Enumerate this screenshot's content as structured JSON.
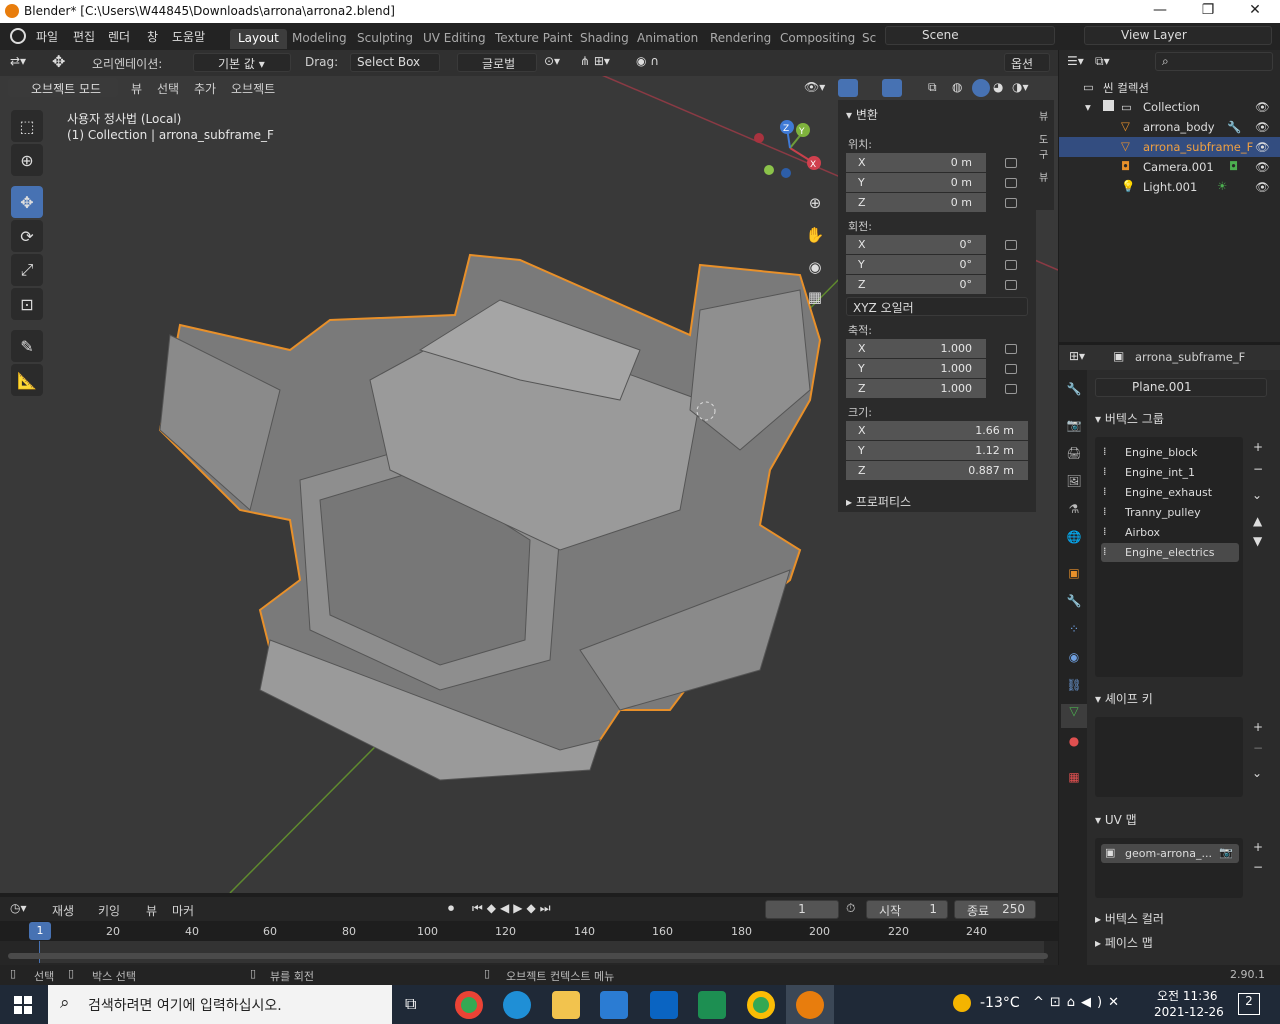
{
  "window": {
    "title": "Blender* [C:\\Users\\W44845\\Downloads\\arrona\\arrona2.blend]"
  },
  "menu": [
    "파일",
    "편집",
    "렌더",
    "창",
    "도움말"
  ],
  "workspace_tabs": [
    {
      "label": "Layout",
      "active": true
    },
    {
      "label": "Modeling"
    },
    {
      "label": "Sculpting"
    },
    {
      "label": "UV Editing"
    },
    {
      "label": "Texture Paint"
    },
    {
      "label": "Shading"
    },
    {
      "label": "Animation"
    },
    {
      "label": "Rendering"
    },
    {
      "label": "Compositing"
    },
    {
      "label": "Sc"
    }
  ],
  "scene": {
    "name": "Scene",
    "view_layer": "View Layer"
  },
  "header": {
    "orientation_label": "오리엔테이션:",
    "orientation_value": "기본 값",
    "drag_label": "Drag:",
    "drag_value": "Select Box",
    "transform": "글로벌",
    "options": "옵션"
  },
  "viewport_header": {
    "mode": "오브젝트 모드",
    "view": "뷰",
    "select": "선택",
    "add": "추가",
    "object": "오브젝트"
  },
  "viewport": {
    "info_line1": "사용자 정사법 (Local)",
    "info_line2": "(1) Collection | arrona_subframe_F",
    "gizmo_x": "X",
    "gizmo_y": "Y",
    "gizmo_z": "Z"
  },
  "npanel": {
    "title": "변환",
    "location_label": "위치:",
    "location": [
      {
        "ax": "X",
        "v": "0 m"
      },
      {
        "ax": "Y",
        "v": "0 m"
      },
      {
        "ax": "Z",
        "v": "0 m"
      }
    ],
    "rotation_label": "회전:",
    "rotation": [
      {
        "ax": "X",
        "v": "0°"
      },
      {
        "ax": "Y",
        "v": "0°"
      },
      {
        "ax": "Z",
        "v": "0°"
      }
    ],
    "rotation_mode": "XYZ 오일러",
    "scale_label": "축적:",
    "scale": [
      {
        "ax": "X",
        "v": "1.000"
      },
      {
        "ax": "Y",
        "v": "1.000"
      },
      {
        "ax": "Z",
        "v": "1.000"
      }
    ],
    "dims_label": "크기:",
    "dims": [
      {
        "ax": "X",
        "v": "1.66 m"
      },
      {
        "ax": "Y",
        "v": "1.12 m"
      },
      {
        "ax": "Z",
        "v": "0.887 m"
      }
    ],
    "properties": "프로퍼티스",
    "side_tabs": [
      "뷰",
      "도구",
      "뷰"
    ]
  },
  "outliner": {
    "root": "씬 컬렉션",
    "items": [
      {
        "label": "Collection"
      },
      {
        "label": "arrona_body"
      },
      {
        "label": "arrona_subframe_F",
        "selected": true
      },
      {
        "label": "Camera.001"
      },
      {
        "label": "Light.001"
      }
    ]
  },
  "properties": {
    "object_name": "arrona_subframe_F",
    "mesh_name": "Plane.001",
    "vertex_groups_title": "버텍스 그룹",
    "vertex_groups": [
      "Engine_block",
      "Engine_int_1",
      "Engine_exhaust",
      "Tranny_pulley",
      "Airbox",
      "Engine_electrics"
    ],
    "shape_keys_title": "셰이프 키",
    "uv_title": "UV 맵",
    "uv_map": "geom-arrona_...",
    "vertex_colors": "버텍스 컬러",
    "face_maps": "페이스 맵"
  },
  "timeline": {
    "playback": "재생",
    "keying": "키잉",
    "view": "뷰",
    "marker": "마커",
    "current_frame": "1",
    "start_label": "시작",
    "start": "1",
    "end_label": "종료",
    "end": "250",
    "ticks": [
      "20",
      "40",
      "60",
      "80",
      "100",
      "120",
      "140",
      "160",
      "180",
      "200",
      "220",
      "240"
    ],
    "cursor": "1"
  },
  "status": {
    "select": "선택",
    "box_select": "박스 선택",
    "rotate_view": "뷰를 회전",
    "context_menu": "오브젝트 컨텍스트 메뉴",
    "version": "2.90.1"
  },
  "taskbar": {
    "search_placeholder": "검색하려면 여기에 입력하십시오.",
    "weather": "-13°C",
    "time": "오전 11:36",
    "date": "2021-12-26",
    "notifications": "2"
  },
  "colors": {
    "accent": "#4772b3",
    "selection_outline": "#e8902a",
    "active_row": "#334d80"
  }
}
